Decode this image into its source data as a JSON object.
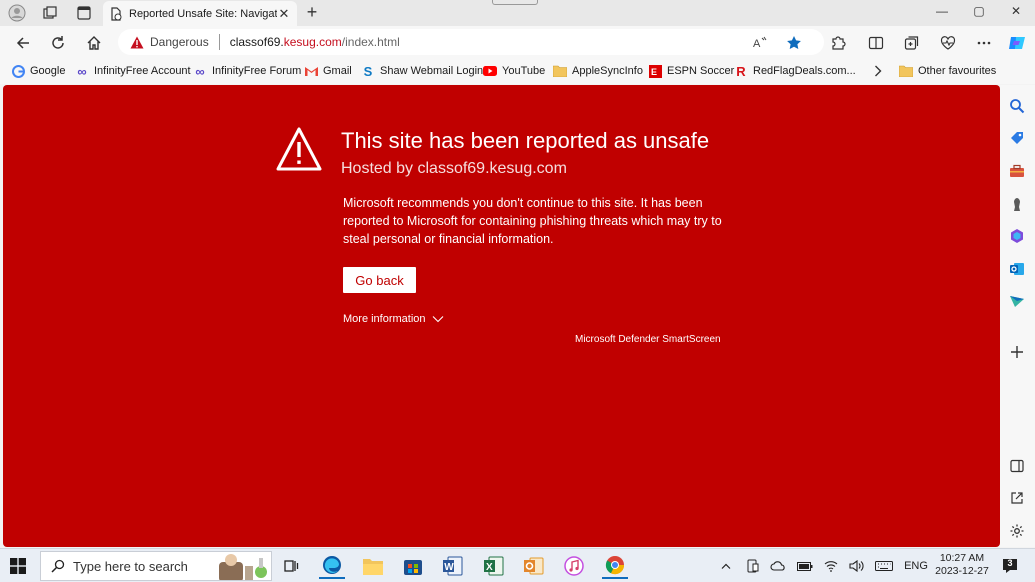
{
  "browser": {
    "tab_title": "Reported Unsafe Site: Navigation",
    "tab_close": "✕",
    "new_tab": "+",
    "window": {
      "minimize": "—",
      "maximize": "▢",
      "close": "✕"
    }
  },
  "addressbar": {
    "security_label": "Dangerous",
    "url_pre": "classof69.",
    "url_domain": "kesug.com",
    "url_path": "/index.html"
  },
  "favorites": [
    {
      "label": "Google",
      "icon": "google-icon"
    },
    {
      "label": "InfinityFree Account",
      "icon": "infinity-icon"
    },
    {
      "label": "InfinityFree Forum",
      "icon": "infinity-icon"
    },
    {
      "label": "Gmail",
      "icon": "gmail-icon"
    },
    {
      "label": "Shaw Webmail Login",
      "icon": "shaw-icon"
    },
    {
      "label": "YouTube",
      "icon": "youtube-icon"
    },
    {
      "label": "AppleSyncInfo",
      "icon": "folder-icon"
    },
    {
      "label": "ESPN Soccer",
      "icon": "espn-icon"
    },
    {
      "label": "RedFlagDeals.com...",
      "icon": "rfd-icon"
    }
  ],
  "other_favourites": "Other favourites",
  "warning": {
    "title": "This site has been reported as unsafe",
    "hosted_by": "Hosted by classof69.kesug.com",
    "body": "Microsoft recommends you don't continue to this site. It has been reported to Microsoft for containing phishing threats which may try to steal personal or financial information.",
    "go_back": "Go back",
    "more_info": "More information",
    "footer": "Microsoft Defender SmartScreen"
  },
  "taskbar": {
    "search_placeholder": "Type here to search",
    "language": "ENG",
    "time": "10:27 AM",
    "date": "2023-12-27",
    "notifications": "3"
  },
  "colors": {
    "danger_red": "#c00000",
    "url_red": "#c50f1f",
    "favorite_star": "#0f6cbd"
  }
}
